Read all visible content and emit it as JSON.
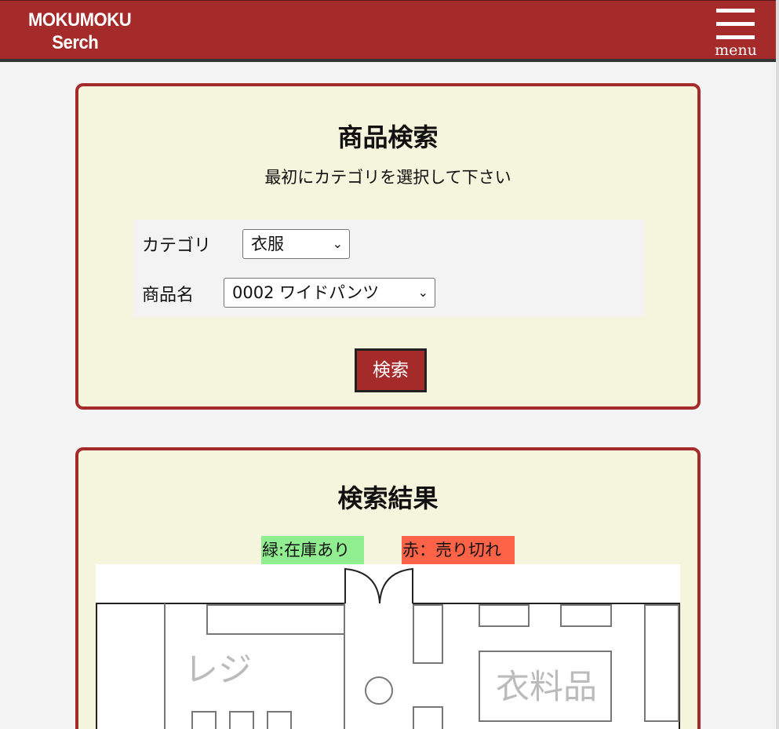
{
  "header": {
    "logo_line1": "MOKUMOKU",
    "logo_line2": "Serch",
    "menu_label": "menu"
  },
  "search_panel": {
    "title": "商品検索",
    "instruction": "最初にカテゴリを選択して下さい",
    "category_label": "カテゴリ",
    "category_value": "衣服",
    "product_label": "商品名",
    "product_value": "0002 ワイドパンツ",
    "search_button": "検索"
  },
  "result_panel": {
    "title": "検索結果",
    "legend_in_stock": "緑:在庫あり",
    "legend_sold_out": "赤：売り切れ",
    "map": {
      "register_label": "レジ",
      "clothing_label": "衣料品"
    }
  },
  "colors": {
    "brand": "#a52a2a",
    "panel_bg": "#f5f4dc",
    "in_stock": "#90ee90",
    "sold_out": "#ff6347"
  }
}
